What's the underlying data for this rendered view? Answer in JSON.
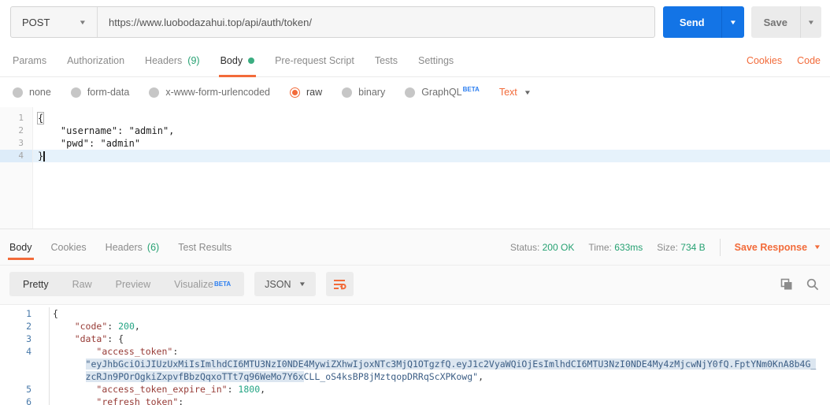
{
  "icons": {
    "caret": "▼"
  },
  "request_bar": {
    "method": "POST",
    "url": "https://www.luobodazahui.top/api/auth/token/",
    "send_label": "Send",
    "save_label": "Save"
  },
  "request_tabs": {
    "items": [
      {
        "label": "Params"
      },
      {
        "label": "Authorization"
      },
      {
        "label": "Headers",
        "count": "(9)"
      },
      {
        "label": "Body"
      },
      {
        "label": "Pre-request Script"
      },
      {
        "label": "Tests"
      },
      {
        "label": "Settings"
      }
    ],
    "active_tab": "Body",
    "cookies_link": "Cookies",
    "code_link": "Code"
  },
  "body_type_bar": {
    "options": [
      "none",
      "form-data",
      "x-www-form-urlencoded",
      "raw",
      "binary",
      "GraphQL"
    ],
    "selected": "raw",
    "graphql_beta": "BETA",
    "format_selected": "Text"
  },
  "request_editor": {
    "nums": [
      "1",
      "2",
      "3",
      "4"
    ],
    "l1": "{",
    "l2": "    \"username\": \"admin\",",
    "l3": "    \"pwd\": \"admin\"",
    "l4": "}"
  },
  "response_meta": {
    "tabs": [
      {
        "label": "Body"
      },
      {
        "label": "Cookies"
      },
      {
        "label": "Headers",
        "count": "(6)"
      },
      {
        "label": "Test Results"
      }
    ],
    "active_tab": "Body",
    "status_label": "Status:",
    "status_value": "200 OK",
    "time_label": "Time:",
    "time_value": "633ms",
    "size_label": "Size:",
    "size_value": "734 B",
    "save_response_label": "Save Response"
  },
  "response_toolbar": {
    "views": [
      "Pretty",
      "Raw",
      "Preview",
      "Visualize"
    ],
    "active_view": "Pretty",
    "visualize_beta": "BETA",
    "language": "JSON"
  },
  "response_body": {
    "nums": [
      "1",
      "2",
      "3",
      "4",
      "",
      "",
      "5",
      "6"
    ],
    "l1_punct": "{",
    "l2_ws": "    ",
    "l2_key": "\"code\"",
    "l2_sep": ": ",
    "l2_val": "200",
    "l2_end": ",",
    "l3_ws": "    ",
    "l3_key": "\"data\"",
    "l3_sep": ": {",
    "l4_ws": "        ",
    "l4_key": "\"access_token\"",
    "l4_sep": ":",
    "t1_ws": "      ",
    "t1_sel": "\"eyJhbGciOiJIUzUxMiIsImlhdCI6MTU3NzI0NDE4MywiZXhwIjoxNTc3MjQ1OTgzfQ.eyJ1c2VyaWQiOjEsImlhdCI6MTU3NzI0NDE4My4zMjcwNjY0fQ.FptYNm0KnA8b4G_",
    "t2_ws": "      ",
    "t2_sel": "zcRJn9POrOgkiZxpvfBbzQqxoTTt7q96WeMo7Y6x",
    "t2_rest": "CLL_oS4ksBP8jMztqopDRRqScXPKowg\"",
    "t2_end": ",",
    "l5_ws": "        ",
    "l5_key": "\"access_token_expire_in\"",
    "l5_sep": ": ",
    "l5_val": "1800",
    "l5_end": ",",
    "l6_ws": "        ",
    "l6_key": "\"refresh_token\"",
    "l6_sep": ":"
  }
}
